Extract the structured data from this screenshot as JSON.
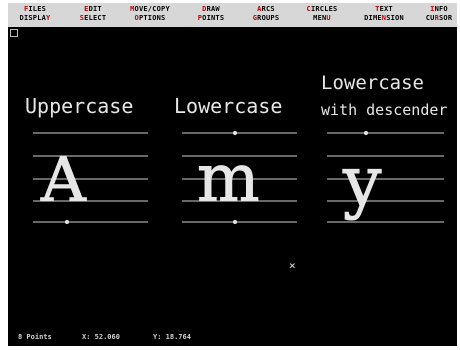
{
  "menu": [
    {
      "top": "FILES",
      "top_hl": "F",
      "bottom": "DISPLAY",
      "bottom_hl": "Y"
    },
    {
      "top": "EDIT",
      "top_hl": "E",
      "bottom": "SELECT",
      "bottom_hl": "S"
    },
    {
      "top": "MOVE/COPY",
      "top_hl": "M",
      "bottom": "OPTIONS",
      "bottom_hl": "O"
    },
    {
      "top": "DRAW",
      "top_hl": "D",
      "bottom": "POINTS",
      "bottom_hl": "P"
    },
    {
      "top": "ARCS",
      "top_hl": "A",
      "bottom": "GROUPS",
      "bottom_hl": "G"
    },
    {
      "top": "CIRCLES",
      "top_hl": "C",
      "bottom": "MENU",
      "bottom_hl": "U"
    },
    {
      "top": "TEXT",
      "top_hl": "T",
      "bottom": "DIMENSION",
      "bottom_hl": "N"
    },
    {
      "top": "INFO",
      "top_hl": "I",
      "bottom": "CURSOR",
      "bottom_hl": "R"
    }
  ],
  "canvas": {
    "label_uppercase": "Uppercase",
    "label_lowercase": "Lowercase",
    "label_lowercase_desc_1": "Lowercase",
    "label_lowercase_desc_2": "with descender",
    "letter_upper": "A",
    "letter_lower": "m",
    "letter_desc": "y",
    "cursor_glyph": "×"
  },
  "status": {
    "points": "8 Points",
    "x": "X: 52.060",
    "y": "Y: 18.764"
  },
  "colors": {
    "menubar_bg": "#d7d7d7",
    "menu_highlight": "#c00000",
    "canvas_bg": "#000000",
    "guide_line": "#cfcfcf"
  }
}
